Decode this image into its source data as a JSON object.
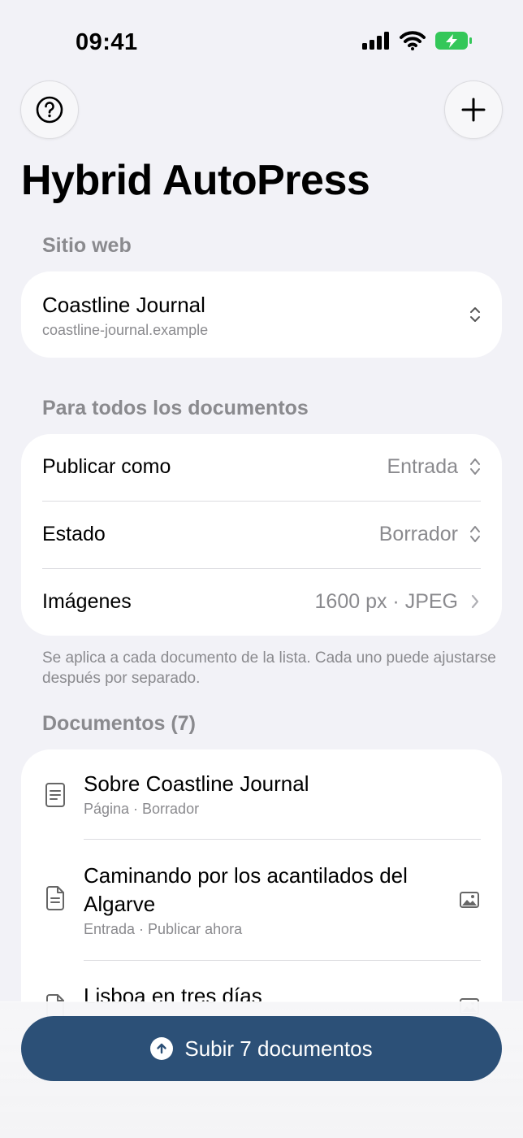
{
  "status_bar": {
    "time": "09:41"
  },
  "header": {
    "title": "Hybrid AutoPress"
  },
  "site_section": {
    "header": "Sitio web",
    "site_name": "Coastline Journal",
    "site_url": "coastline-journal.example"
  },
  "defaults_section": {
    "header": "Para todos los documentos",
    "rows": [
      {
        "label": "Publicar como",
        "value": "Entrada"
      },
      {
        "label": "Estado",
        "value": "Borrador"
      },
      {
        "label": "Imágenes",
        "value": "1600 px · JPEG"
      }
    ],
    "footnote": "Se aplica a cada documento de la lista. Cada uno puede ajustarse después por separado."
  },
  "documents_section": {
    "header": "Documentos (7)",
    "items": [
      {
        "title": "Sobre Coastline Journal",
        "subtitle": "Página · Borrador"
      },
      {
        "title": "Caminando por los acantilados del Algarve",
        "subtitle": "Entrada · Publicar ahora"
      },
      {
        "title": "Lisboa en tres días",
        "subtitle": ""
      }
    ]
  },
  "upload_button": {
    "label": "Subir 7 documentos"
  },
  "colors": {
    "accent": "#2c5077",
    "background": "#f2f2f7",
    "secondary_text": "#8a8a8e",
    "battery": "#34c759"
  },
  "icons": [
    "help-icon",
    "plus-icon",
    "updown-chevron-icon",
    "chevron-right-icon",
    "page-icon",
    "document-icon",
    "image-icon",
    "arrow-up-circle-icon"
  ]
}
